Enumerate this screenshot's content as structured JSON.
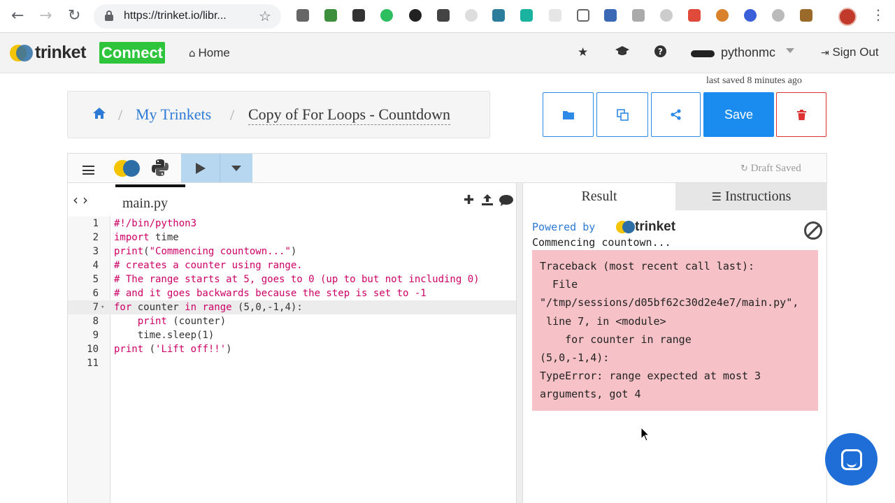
{
  "browser": {
    "url": "https://trinket.io/libr...",
    "back_icon": "arrow-left-icon",
    "forward_icon": "arrow-right-icon",
    "reload_icon": "reload-icon",
    "menu_icon": "kebab-icon"
  },
  "nav": {
    "logo_text": "trinket",
    "badge": "Connect",
    "home": "Home",
    "username": "pythonmc",
    "signout": "Sign Out",
    "colors": {
      "badge": "#2ec53d",
      "link": "#2d7ad6"
    }
  },
  "status": {
    "last_saved": "last saved 8 minutes ago"
  },
  "breadcrumb": {
    "link": "My Trinkets",
    "separator": "/",
    "title": "Copy of For Loops - Countdown"
  },
  "actions": {
    "save": "Save"
  },
  "editor": {
    "draft_status": "Draft Saved",
    "filename": "main.py",
    "active_line": 7,
    "lines": [
      {
        "n": "1",
        "text": "#!/bin/python3"
      },
      {
        "n": "2",
        "text": "import time"
      },
      {
        "n": "3",
        "text": "print(\"Commencing countown...\")"
      },
      {
        "n": "4",
        "text": "# creates a counter using range."
      },
      {
        "n": "5",
        "text": "# The range starts at 5, goes to 0 (up to but not including 0)"
      },
      {
        "n": "6",
        "text": "# and it goes backwards because the step is set to -1"
      },
      {
        "n": "7",
        "text": "for counter in range (5,0,-1,4):"
      },
      {
        "n": "8",
        "text": "    print (counter)"
      },
      {
        "n": "9",
        "text": "    time.sleep(1)"
      },
      {
        "n": "10",
        "text": "print ('Lift off!!')"
      },
      {
        "n": "11",
        "text": ""
      }
    ]
  },
  "result": {
    "tab_result": "Result",
    "tab_instructions": "Instructions",
    "powered_by": "Powered by",
    "powered_logo": "trinket",
    "stdout": "Commencing countown...",
    "error_lines": [
      "Traceback (most recent call last):",
      "  File",
      "\"/tmp/sessions/d05bf62c30d2e4e7/main.py\",",
      " line 7, in <module>",
      "    for counter in range",
      "(5,0,-1,4):",
      "TypeError: range expected at most 3",
      "arguments, got 4"
    ],
    "error_bg": "#f6c1c7"
  }
}
